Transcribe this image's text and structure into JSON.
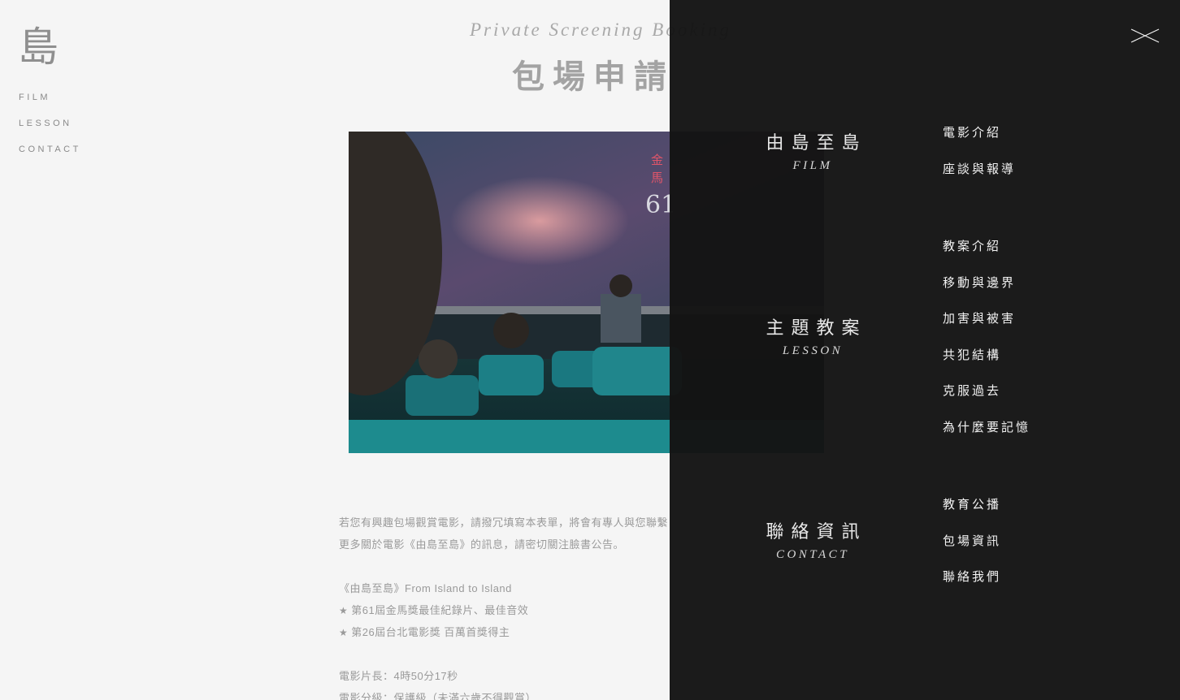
{
  "logo": "島",
  "side_nav": [
    "FILM",
    "LESSON",
    "CONTACT"
  ],
  "heading": {
    "eyebrow": "Private Screening Booking",
    "title": "包場申請"
  },
  "hero": {
    "poster_text": [
      "金",
      "馬",
      "61"
    ]
  },
  "intro": {
    "line1": "若您有興趣包場觀賞電影，請撥冗填寫本表單，將會有專人與您聯繫",
    "line2": "更多關於電影《由島至島》的訊息，請密切關注臉書公告。",
    "film_title": "《由島至島》From Island to Island",
    "award1": "第61屆金馬獎最佳紀錄片、最佳音效",
    "award2": "第26屆台北電影獎 百萬首獎得主",
    "runtime": "電影片長：4時50分17秒",
    "rating": "電影分級：保護級（未滿六歲不得觀賞）"
  },
  "menu": {
    "sections": [
      {
        "zh": "由島至島",
        "en": "FILM",
        "items": [
          "電影介紹",
          "座談與報導"
        ]
      },
      {
        "zh": "主題教案",
        "en": "LESSON",
        "items": [
          "教案介紹",
          "移動與邊界",
          "加害與被害",
          "共犯結構",
          "克服過去",
          "為什麼要記憶"
        ]
      },
      {
        "zh": "聯絡資訊",
        "en": "CONTACT",
        "items": [
          "教育公播",
          "包場資訊",
          "聯絡我們"
        ]
      }
    ]
  },
  "icons": {
    "close": "close-icon",
    "star": "star-icon"
  },
  "colors": {
    "page_bg": "#f5f5f5",
    "overlay_bg": "#141414",
    "menu_text": "#f2f2f2"
  }
}
